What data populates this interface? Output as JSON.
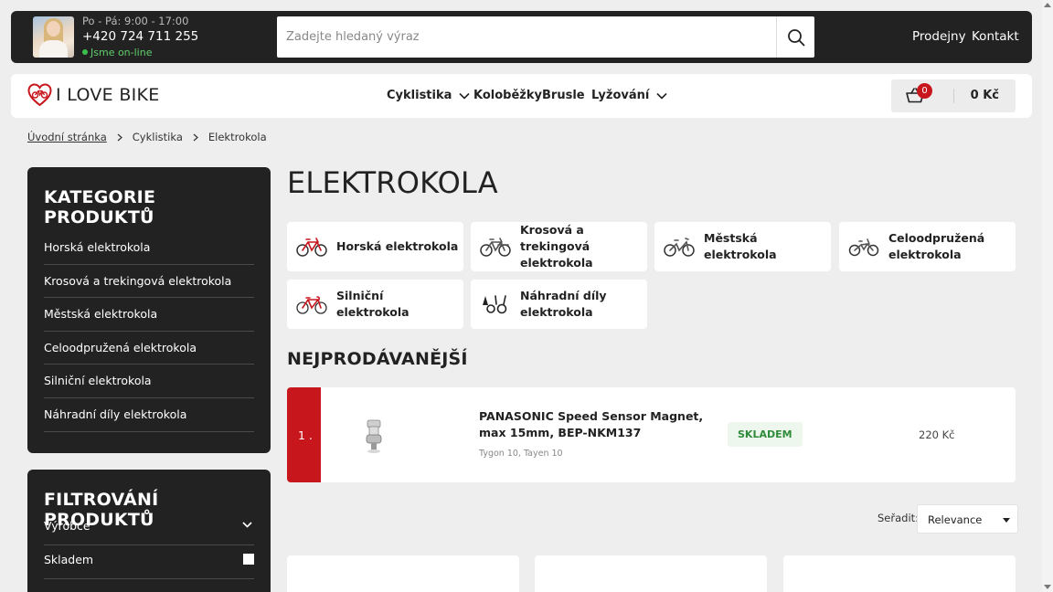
{
  "topbar": {
    "hours": "Po - Pá: 9:00 - 17:00",
    "phone": "+420 724 711 255",
    "status": "Jsme on-line",
    "search_placeholder": "Zadejte hledaný výraz",
    "links": [
      "Prodejny",
      "Kontakt"
    ]
  },
  "navbar": {
    "logo": "I LOVE BIKE",
    "items": [
      "Cyklistika",
      "Koloběžky",
      "Brusle",
      "Lyžování"
    ],
    "cart": {
      "count": "0",
      "total": "0 Kč"
    }
  },
  "breadcrumb": [
    "Úvodní stránka",
    "Cyklistika",
    "Elektrokola"
  ],
  "sidebar": {
    "categories_title": "KATEGORIE PRODUKTŮ",
    "categories": [
      "Horská elektrokola",
      "Krosová a trekingová elektrokola",
      "Městská elektrokola",
      "Celoodpružená elektrokola",
      "Silniční elektrokola",
      "Náhradní díly elektrokola"
    ],
    "filter_title": "FILTROVÁNÍ PRODUKTŮ",
    "filters": [
      "Výrobce",
      "Skladem"
    ]
  },
  "main": {
    "title": "ELEKTROKOLA",
    "tiles": [
      {
        "label": "Horská elektrokola",
        "icon": "mtb-bike-icon",
        "color": "#c8161d"
      },
      {
        "label": "Krosová a trekingová elektrokola",
        "icon": "trekking-bike-icon",
        "color": "#555555"
      },
      {
        "label": "Městská elektrokola",
        "icon": "city-bike-icon",
        "color": "#555555"
      },
      {
        "label": "Celoodpružená elektrokola",
        "icon": "full-suspension-bike-icon",
        "color": "#555555"
      },
      {
        "label": "Silniční elektrokola",
        "icon": "road-bike-icon",
        "color": "#c8161d"
      },
      {
        "label": "Náhradní díly elektrokola",
        "icon": "spare-parts-icon",
        "color": "#222222"
      }
    ],
    "bestsellers_title": "NEJPRODÁVANĚJŠÍ",
    "bestseller": {
      "rank": "1 .",
      "name": "PANASONIC Speed Sensor Magnet, max 15mm, BEP-NKM137",
      "variants": "Tygon 10, Tayen 10",
      "stock": "SKLADEM",
      "price": "220 Kč"
    },
    "sort_label": "Seřadit:",
    "sort_value": "Relevance"
  },
  "colors": {
    "accent": "#c8161d",
    "dark": "#222222",
    "online": "#39c14a"
  }
}
